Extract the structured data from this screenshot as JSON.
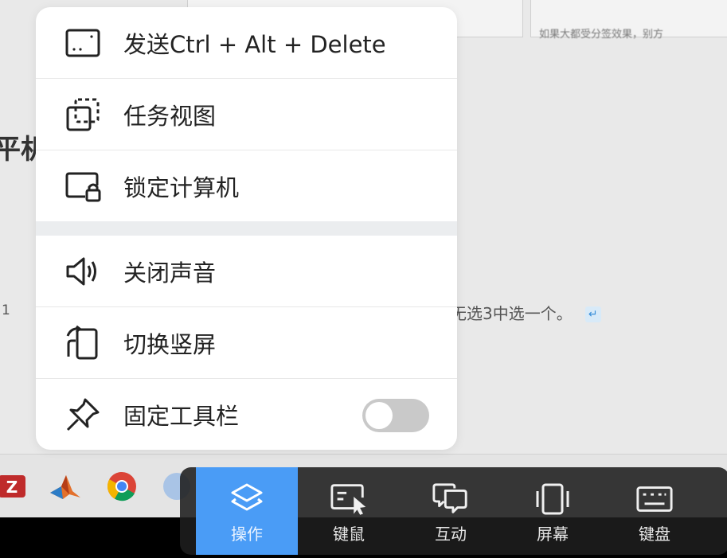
{
  "background": {
    "doc_fragment": "如果大都受分签效果，别方",
    "heading_fragment": "平机",
    "line_number": "1",
    "text_fragment": "无选3中选一个。"
  },
  "menu": {
    "items": [
      {
        "label": "发送Ctrl + Alt + Delete",
        "icon": "keyboard-box-icon"
      },
      {
        "label": "任务视图",
        "icon": "task-view-icon"
      },
      {
        "label": "锁定计算机",
        "icon": "lock-computer-icon"
      },
      {
        "label": "关闭声音",
        "icon": "speaker-icon"
      },
      {
        "label": "切换竖屏",
        "icon": "rotate-screen-icon"
      },
      {
        "label": "固定工具栏",
        "icon": "pin-icon"
      }
    ],
    "pin_toolbar_enabled": false
  },
  "taskbar": {
    "apps": [
      "filezilla-icon",
      "matlab-icon",
      "chrome-icon",
      "app-icon"
    ]
  },
  "toolbar": {
    "items": [
      {
        "label": "操作",
        "icon": "layers-icon",
        "active": true
      },
      {
        "label": "键鼠",
        "icon": "keyboard-mouse-icon",
        "active": false
      },
      {
        "label": "互动",
        "icon": "chat-icon",
        "active": false
      },
      {
        "label": "屏幕",
        "icon": "screen-icon",
        "active": false
      },
      {
        "label": "键盘",
        "icon": "keyboard-icon",
        "active": false
      }
    ],
    "accent_color": "#4a9cf6"
  }
}
